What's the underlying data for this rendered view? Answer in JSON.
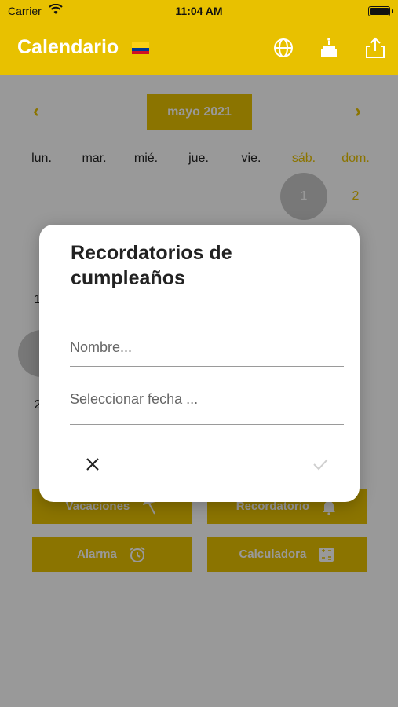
{
  "status_bar": {
    "carrier": "Carrier",
    "time": "11:04 AM"
  },
  "navbar": {
    "title": "Calendario",
    "flag_colors": [
      "#fcd116",
      "#003893",
      "#ce1126"
    ],
    "icons": [
      "globe-icon",
      "birthday-cake-icon",
      "share-icon"
    ]
  },
  "calendar": {
    "prev_icon": "‹",
    "next_icon": "›",
    "month_label": "mayo 2021",
    "weekdays": [
      "lun.",
      "mar.",
      "mié.",
      "jue.",
      "vie.",
      "sáb.",
      "dom."
    ],
    "visible_days": {
      "sat_1": "1",
      "sun_2": "2",
      "partial_1": "1",
      "partial_2": "2"
    }
  },
  "actions": {
    "vacaciones": "Vacaciones",
    "recordatorio": "Recordatorio",
    "alarma": "Alarma",
    "calculadora": "Calculadora"
  },
  "dialog": {
    "title": "Recordatorios de cumpleaños",
    "name_placeholder": "Nombre...",
    "date_placeholder": "Seleccionar fecha ...",
    "cancel_icon": "close-icon",
    "confirm_icon": "check-icon"
  },
  "colors": {
    "accent": "#e8c100",
    "overlay": "rgba(0,0,0,0.4)"
  }
}
